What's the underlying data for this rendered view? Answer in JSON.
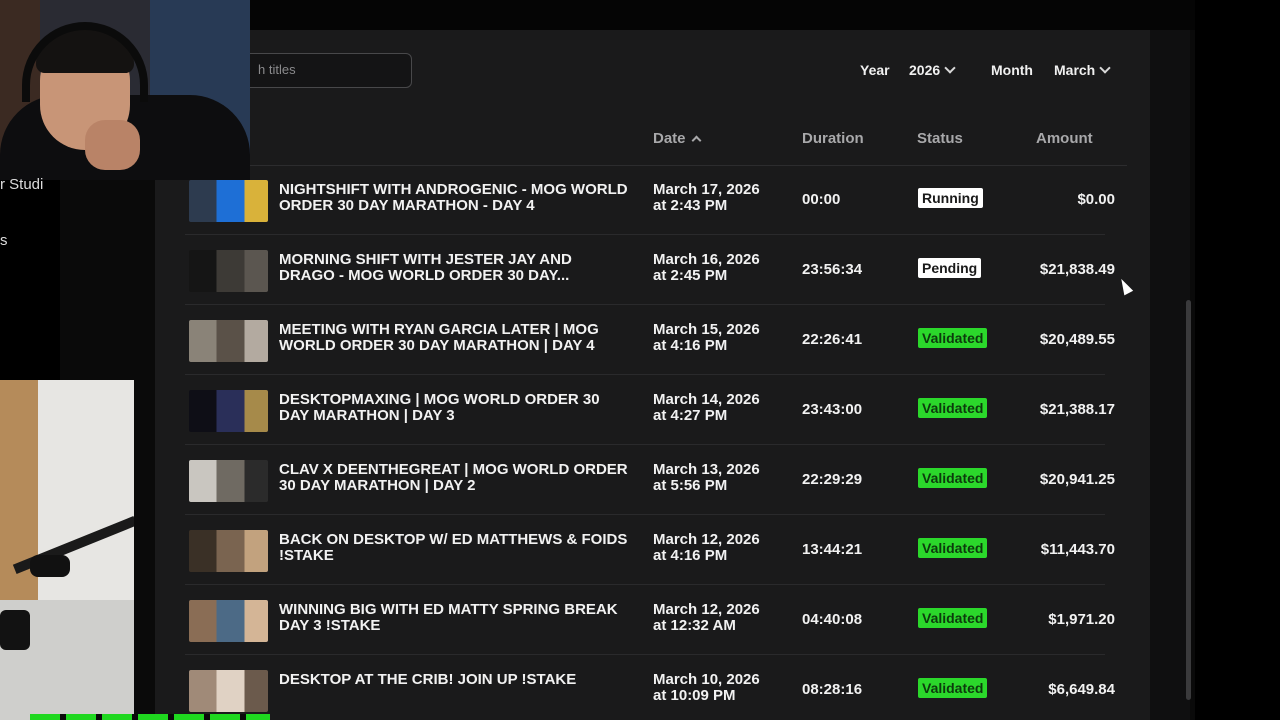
{
  "search": {
    "placeholder": "h titles"
  },
  "filters": {
    "year_label": "Year",
    "year_value": "2026",
    "month_label": "Month",
    "month_value": "March"
  },
  "columns": {
    "date": "Date",
    "duration": "Duration",
    "status": "Status",
    "amount": "Amount"
  },
  "overlay_text": {
    "studio_line1": "r Studi",
    "studio_line2": "s"
  },
  "rows": [
    {
      "title": "NIGHTSHIFT WITH ANDROGENIC - MOG WORLD ORDER 30 DAY MARATHON - DAY 4",
      "date_line1": "March 17, 2026",
      "date_line2": "at 2:43 PM",
      "duration": "00:00",
      "status": "Running",
      "amount": "$0.00",
      "thumb_colors": [
        "#2d3b4f",
        "#1e6fd6",
        "#d9b23a"
      ]
    },
    {
      "title": "MORNING SHIFT WITH JESTER JAY AND DRAGO - MOG WORLD ORDER 30 DAY...",
      "date_line1": "March 16, 2026",
      "date_line2": "at 2:45 PM",
      "duration": "23:56:34",
      "status": "Pending",
      "amount": "$21,838.49",
      "thumb_colors": [
        "#151515",
        "#3d3a36",
        "#5b5650"
      ]
    },
    {
      "title": "MEETING WITH RYAN GARCIA LATER | MOG WORLD ORDER 30 DAY MARATHON | DAY 4",
      "date_line1": "March 15, 2026",
      "date_line2": "at 4:16 PM",
      "duration": "22:26:41",
      "status": "Validated",
      "amount": "$20,489.55",
      "thumb_colors": [
        "#8a8378",
        "#5a5148",
        "#b3aaa0"
      ]
    },
    {
      "title": "DESKTOPMAXING | MOG WORLD ORDER 30 DAY MARATHON | DAY 3",
      "date_line1": "March 14, 2026",
      "date_line2": "at 4:27 PM",
      "duration": "23:43:00",
      "status": "Validated",
      "amount": "$21,388.17",
      "thumb_colors": [
        "#0e0e16",
        "#2a2f59",
        "#a68a4a"
      ]
    },
    {
      "title": "CLAV X DEENTHEGREAT | MOG WORLD ORDER 30 DAY MARATHON | DAY 2",
      "date_line1": "March 13, 2026",
      "date_line2": "at 5:56 PM",
      "duration": "22:29:29",
      "status": "Validated",
      "amount": "$20,941.25",
      "thumb_colors": [
        "#c9c6c0",
        "#6f6a62",
        "#2b2b2b"
      ]
    },
    {
      "title": "BACK ON DESKTOP W/ ED MATTHEWS & FOIDS !stake",
      "date_line1": "March 12, 2026",
      "date_line2": "at 4:16 PM",
      "duration": "13:44:21",
      "status": "Validated",
      "amount": "$11,443.70",
      "thumb_colors": [
        "#3a3026",
        "#7a6450",
        "#c2a27e"
      ]
    },
    {
      "title": "WINNING BIG WITH ED MATTY SPRING BREAK DAY 3 !stake",
      "date_line1": "March 12, 2026",
      "date_line2": "at 12:32 AM",
      "duration": "04:40:08",
      "status": "Validated",
      "amount": "$1,971.20",
      "thumb_colors": [
        "#8a6d55",
        "#4c6a86",
        "#d4b596"
      ]
    },
    {
      "title": "DESKTOP AT THE CRIB! JOIN UP !stake",
      "date_line1": "March 10, 2026",
      "date_line2": "at 10:09 PM",
      "duration": "08:28:16",
      "status": "Validated",
      "amount": "$6,649.84",
      "thumb_colors": [
        "#a08a78",
        "#e0d2c4",
        "#6b5a4c"
      ]
    }
  ],
  "colors": {
    "validated": "#2bd82b",
    "panel": "#1a1a1b",
    "background": "#0a0a0a"
  }
}
